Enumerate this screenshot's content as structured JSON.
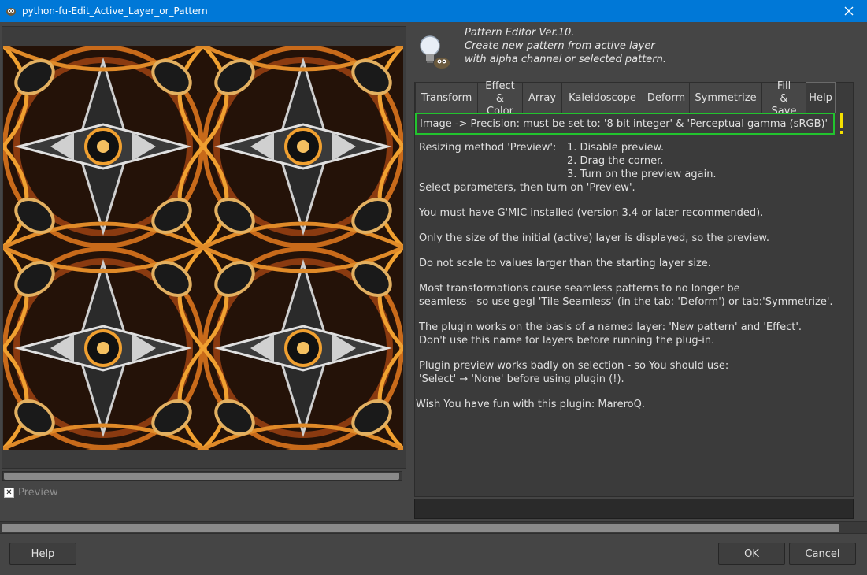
{
  "window": {
    "title": "python-fu-Edit_Active_Layer_or_Pattern"
  },
  "preview": {
    "checkbox_label": "Preview",
    "checked": true,
    "check_glyph": "✕"
  },
  "header": {
    "line1": "Pattern Editor Ver.10.",
    "line2": "Create new pattern from active layer",
    "line3": "with alpha channel or selected pattern."
  },
  "tabs": [
    {
      "label": "Transform"
    },
    {
      "label1": "Effect",
      "label2": "& Color"
    },
    {
      "label": "Array"
    },
    {
      "label": "Kaleidoscope"
    },
    {
      "label": "Deform"
    },
    {
      "label": "Symmetrize"
    },
    {
      "label1": "Fill",
      "label2": "& Save"
    },
    {
      "label": "Help",
      "active": true
    }
  ],
  "help": {
    "warning": "Image -> Precision: must be set to: '8 bit integer' & 'Perceptual gamma (sRGB)'",
    "resize_label": "Resizing method 'Preview':",
    "resize_steps": [
      "1. Disable preview.",
      "2. Drag the corner.",
      "3. Turn on the preview again."
    ],
    "select_params": "Select parameters, then turn on 'Preview'.",
    "gmic": "You must have G'MIC installed (version 3.4 or later recommended).",
    "size_note": "Only the size of the initial (active) layer is displayed, so the preview.",
    "scale_note": "Do not scale to values larger than the starting layer size.",
    "seamless_1": "Most transformations cause seamless patterns to no longer be",
    "seamless_2": "seamless - so use gegl 'Tile Seamless' (in the tab: 'Deform') or tab:'Symmetrize'.",
    "named_1": "The plugin works on the basis of a named layer: 'New pattern' and 'Effect'.",
    "named_2": "Don't use this name for layers before running the plug-in.",
    "selection_1": "Plugin preview works badly on selection - so You should use:",
    "selection_2": "'Select' → 'None' before using plugin (!).",
    "fun": "Wish You have fun with this plugin: MareroQ."
  },
  "buttons": {
    "help": "Help",
    "ok": "OK",
    "cancel": "Cancel"
  },
  "colors": {
    "titlebar": "#0078d7",
    "warning_border": "#22c32e",
    "warning_mark": "#f5e000"
  },
  "icons": {
    "app": "gimp-icon",
    "close": "close-icon",
    "header": "lightbulb-gimp-icon",
    "warning": "exclamation-icon"
  }
}
